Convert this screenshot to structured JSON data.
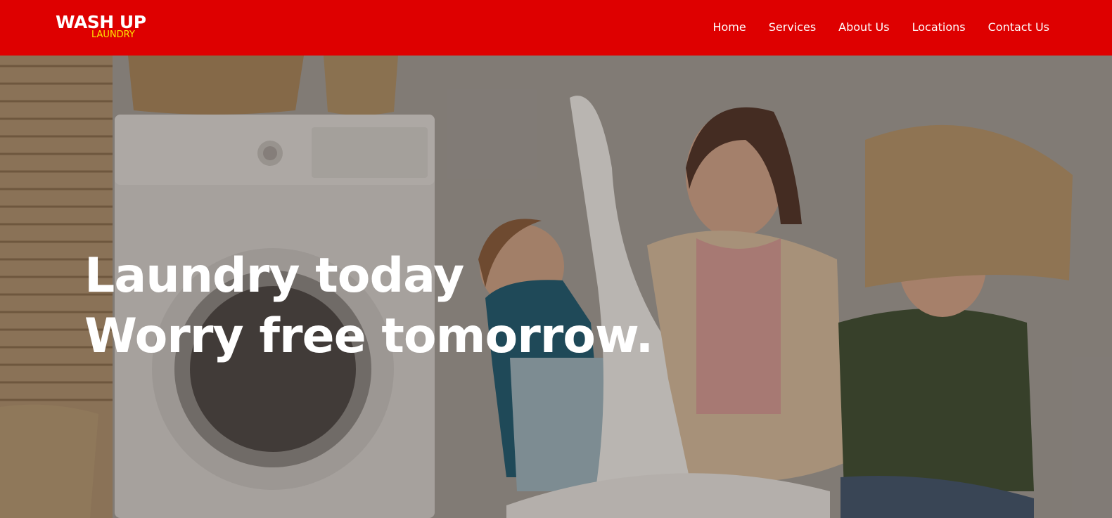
{
  "brand": {
    "name": "WASH UP",
    "tagline": "LAUNDRY",
    "primary_color": "#de0000",
    "tagline_color": "#ffe600"
  },
  "nav": {
    "items": [
      {
        "label": "Home"
      },
      {
        "label": "Services"
      },
      {
        "label": "About Us"
      },
      {
        "label": "Locations"
      },
      {
        "label": "Contact Us"
      }
    ]
  },
  "hero": {
    "line1": "Laundry today",
    "line2": "Worry free tomorrow."
  }
}
